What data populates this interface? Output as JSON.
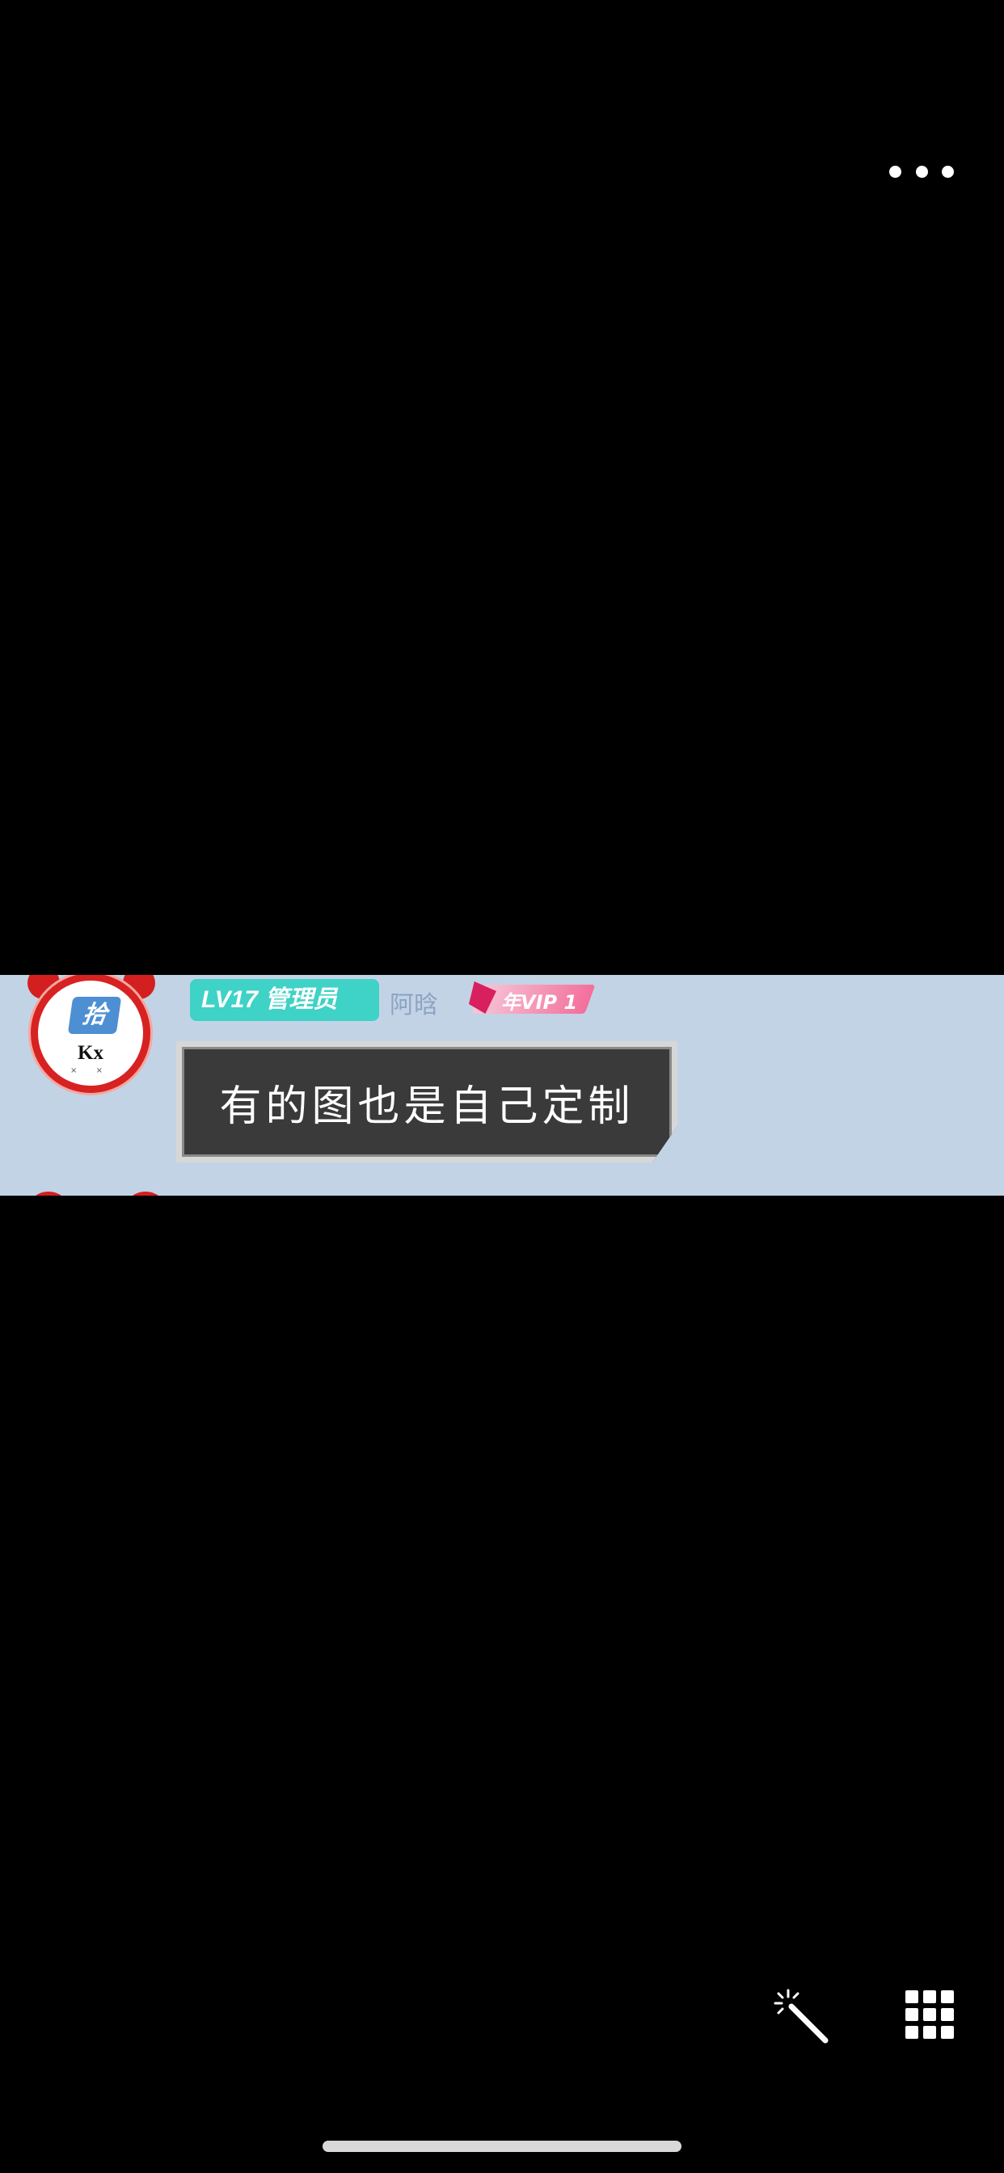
{
  "viewer": {
    "more_icon": "more-horizontal-icon",
    "edit_icon": "magic-wand-icon",
    "grid_icon": "grid-icon"
  },
  "image": {
    "avatar": {
      "logo_text": "拾",
      "name_text": "Kx",
      "sub_text": "× ×"
    },
    "level_badge": "LV17 管理员",
    "username": "阿晗",
    "vip_badge": "年VIP 1",
    "message": "有的图也是自己定制"
  },
  "colors": {
    "background": "#000000",
    "chat_background": "#c3d3e6",
    "level_badge": "#3fd2c6",
    "avatar_ring": "#d72222",
    "bubble": "#3a3a3a"
  }
}
